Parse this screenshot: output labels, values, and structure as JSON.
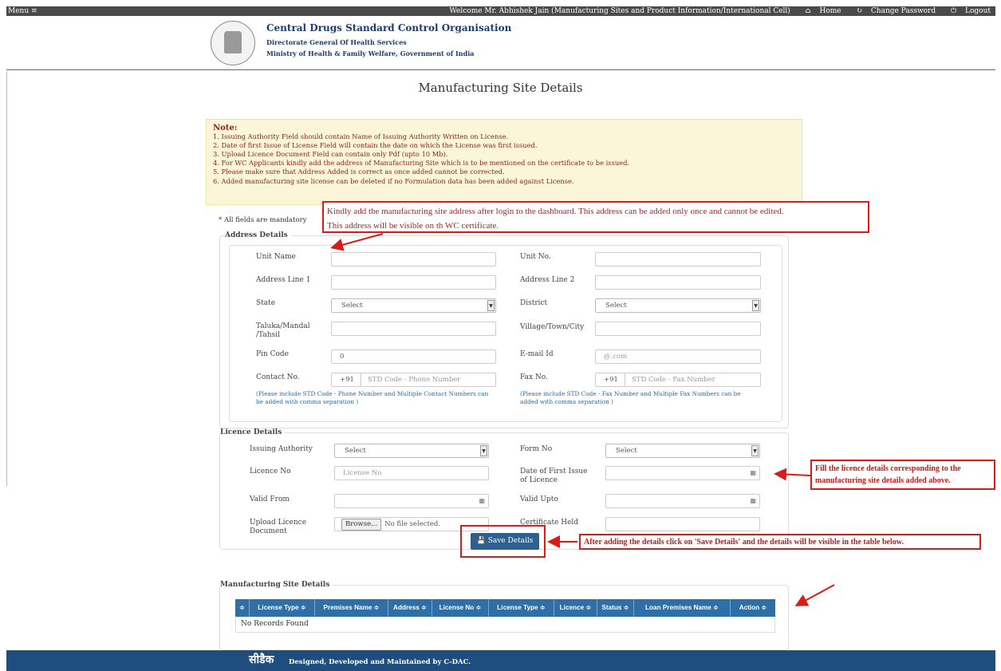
{
  "topbar": {
    "menu": "Menu ≡",
    "welcome": "Welcome Mr. Abhishek Jain (Manufacturing Sites and Product Information/International Cell)",
    "home": "Home",
    "change_password": "Change Password",
    "logout": "Logout",
    "home_icon": "home-icon",
    "refresh_icon": "refresh-icon",
    "power_icon": "power-icon"
  },
  "header": {
    "org_title": "Central Drugs Standard Control Organisation",
    "sub1": "Directorate General Of Health Services",
    "sub2": "Ministry of Health & Family Welfare, Government of India"
  },
  "page_title": "Manufacturing Site Details",
  "note": {
    "heading": "Note:",
    "items": [
      "1. Issuing Authority Field should contain Name of Issuing Authority Written on License.",
      "2. Date of first Issue of License Field will contain the date on which the License was first issued.",
      "3. Upload Licence Document Field can contain only Pdf (upto 10 Mb).",
      "4. For WC Applicants kindly add the address of Manufacturing Site which is to be mentioned on the certificate to be issued.",
      "5. Please make sure that Address Added is correct as once added cannot be corrected.",
      "6. Added manufacturing site license can be deleted if no Formulation data has been added against License."
    ]
  },
  "mandatory": "* All fields are mandatory",
  "annotations": {
    "a1_line1": "Kindly add the manufacturing site address after login to the dashboard. This address can be added only once and cannot be edited.",
    "a1_line2": "This address will be visible on th WC certificate.",
    "a2_line1": "Fill the licence details corresponding to the",
    "a2_line2": "manufacturing site details added above.",
    "a3": "After adding the details click on 'Save Details' and the details will be visible in the table below."
  },
  "address": {
    "legend": "Address Details",
    "unit_name": "Unit Name",
    "unit_no": "Unit No.",
    "addr1": "Address Line 1",
    "addr2": "Address Line 2",
    "state": "State",
    "state_value": "Select",
    "district": "District",
    "district_value": "Select",
    "taluka_line1": "Taluka/Mandal",
    "taluka_line2": "/Tahsil",
    "village": "Village/Town/City",
    "pin": "Pin Code",
    "pin_value": "0",
    "email": "E-mail Id",
    "email_placeholder": "@.com",
    "contact": "Contact No.",
    "contact_prefix": "+91",
    "contact_placeholder": "STD Code - Phone Number",
    "contact_hint1": "(Please include STD Code - Phone Number and Multiple Contact Numbers can",
    "contact_hint2": "be added with comma separation )",
    "fax": "Fax No.",
    "fax_prefix": "+91",
    "fax_placeholder": "STD Code - Fax Number",
    "fax_hint1": "(Please include STD Code - Fax Number and Multiple Fax Numbers can be",
    "fax_hint2": "added with comma separation )"
  },
  "licence": {
    "legend": "Licence Details",
    "issuing": "Issuing Authority",
    "issuing_value": "Select",
    "form_no": "Form No",
    "form_value": "Select",
    "licence_no": "Licence No",
    "licence_placeholder": "License No",
    "doi_line1": "Date of First Issue",
    "doi_line2": "of Licence",
    "valid_from": "Valid From",
    "valid_upto": "Valid Upto",
    "upload_line1": "Upload Licence",
    "upload_line2": "Document",
    "browse": "Browse...",
    "no_file": "No file selected.",
    "certificate": "Certificate Held"
  },
  "save_button": "Save Details",
  "msd": {
    "legend": "Manufacturing Site Details",
    "columns": [
      "≑",
      "License Type ≑",
      "Premises Name ≑",
      "Address ≑",
      "License No ≑",
      "License Type ≑",
      "Licence ≑",
      "Status ≑",
      "Loan Premises Name ≑",
      "Action ≑"
    ],
    "empty": "No Records Found"
  },
  "footer": {
    "logo": "सीडैक",
    "text": "Designed, Developed and Maintained by C-DAC."
  }
}
